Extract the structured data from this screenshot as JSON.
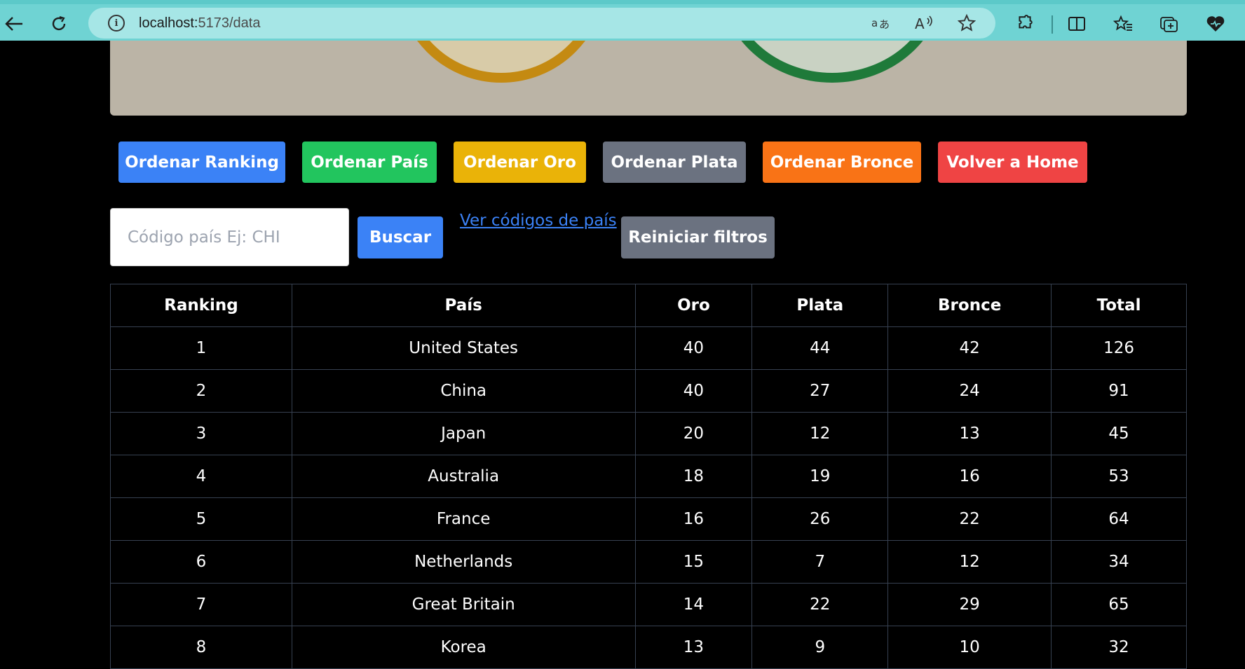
{
  "browser": {
    "url_host": "localhost:",
    "url_rest": "5173/data",
    "icons": {
      "back": "back-arrow-icon",
      "refresh": "refresh-icon",
      "info": "info-icon",
      "translate": "translate-icon",
      "read_aloud": "read-aloud-icon",
      "favorite": "star-icon",
      "extensions": "extensions-icon",
      "split_screen": "split-screen-icon",
      "favorites": "favorites-icon",
      "collections": "collections-icon",
      "health": "browser-essentials-icon"
    }
  },
  "toolbar": {
    "sort_ranking": "Ordenar Ranking",
    "sort_country": "Ordenar País",
    "sort_gold": "Ordenar Oro",
    "sort_silver": "Ordenar Plata",
    "sort_bronze": "Ordenar Bronce",
    "back_home": "Volver a Home"
  },
  "search": {
    "placeholder": "Código país Ej: CHI",
    "value": "",
    "button": "Buscar",
    "codes_link": "Ver códigos de país",
    "reset": "Reiniciar filtros"
  },
  "table": {
    "headers": [
      "Ranking",
      "País",
      "Oro",
      "Plata",
      "Bronce",
      "Total"
    ],
    "rows": [
      [
        "1",
        "United States",
        "40",
        "44",
        "42",
        "126"
      ],
      [
        "2",
        "China",
        "40",
        "27",
        "24",
        "91"
      ],
      [
        "3",
        "Japan",
        "20",
        "12",
        "13",
        "45"
      ],
      [
        "4",
        "Australia",
        "18",
        "19",
        "16",
        "53"
      ],
      [
        "5",
        "France",
        "16",
        "26",
        "22",
        "64"
      ],
      [
        "6",
        "Netherlands",
        "15",
        "7",
        "12",
        "34"
      ],
      [
        "7",
        "Great Britain",
        "14",
        "22",
        "29",
        "65"
      ],
      [
        "8",
        "Korea",
        "13",
        "9",
        "10",
        "32"
      ]
    ]
  },
  "colors": {
    "browser_bar": "#6fd3d3",
    "blue": "#3b82f6",
    "green": "#22c55e",
    "yellow": "#eab308",
    "gray": "#6b7280",
    "orange": "#f97316",
    "red": "#ef4444"
  }
}
